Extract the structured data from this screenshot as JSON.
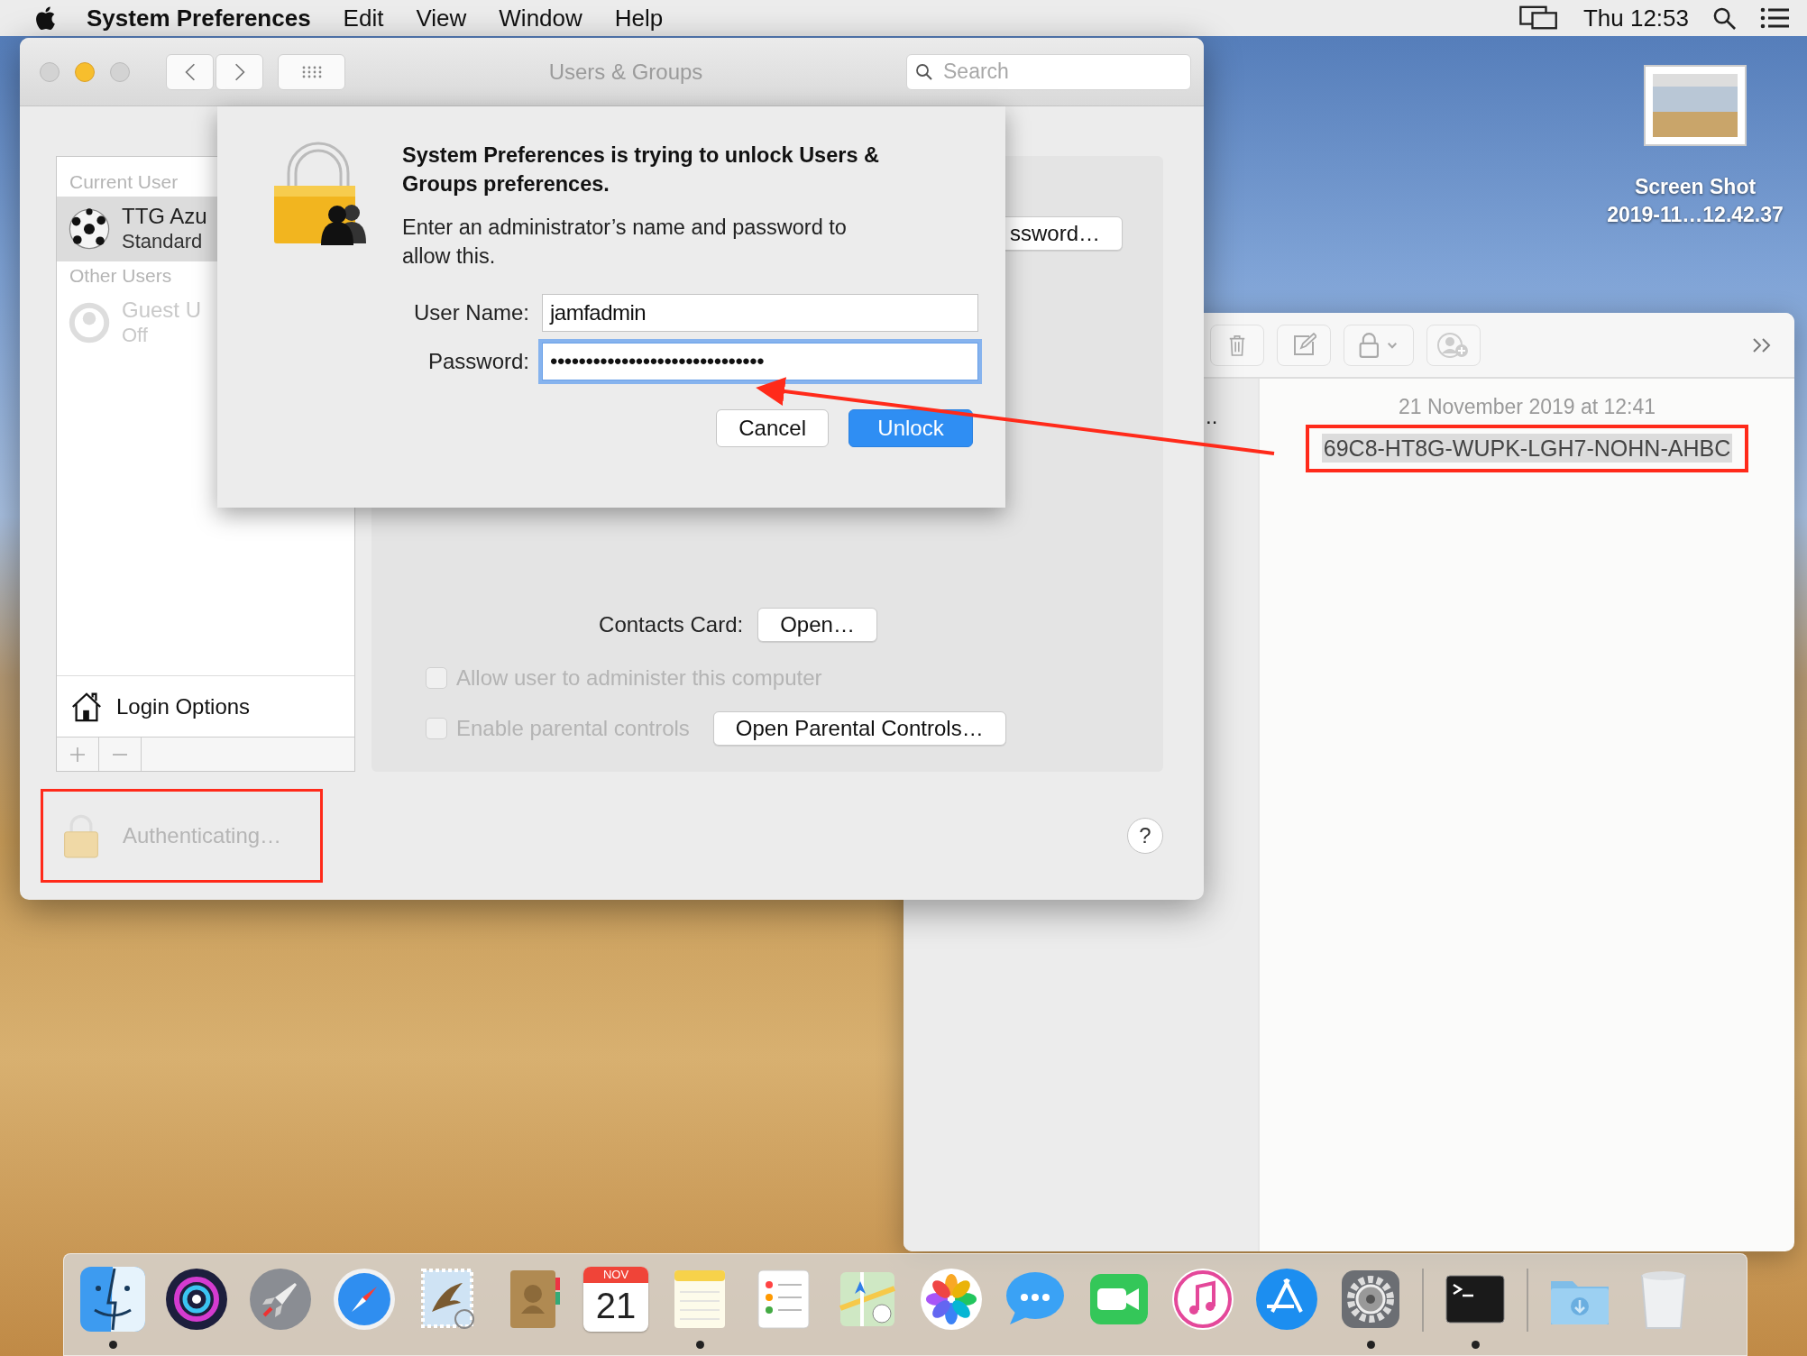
{
  "menu_bar": {
    "app": "System Preferences",
    "menus": [
      "Edit",
      "View",
      "Window",
      "Help"
    ],
    "clock": "Thu 12:53"
  },
  "desktop_icon": {
    "label_lines": [
      "Screen Shot",
      "2019-11…12.42.37"
    ]
  },
  "prefs_window": {
    "title": "Users & Groups",
    "search": {
      "placeholder": "Search"
    },
    "sidebar": {
      "sections": [
        {
          "header": "Current User",
          "users": [
            {
              "name": "TTG Azu",
              "role": "Standard",
              "kind": "ball",
              "selected": true,
              "disabled": false
            }
          ]
        },
        {
          "header": "Other Users",
          "users": [
            {
              "name": "Guest U",
              "role": "Off",
              "kind": "silhouette",
              "selected": false,
              "disabled": true
            }
          ]
        }
      ],
      "login_options": "Login Options"
    },
    "panel": {
      "password_button": "ssword…",
      "contacts_label": "Contacts Card:",
      "contacts_button": "Open…",
      "checkboxes": [
        {
          "label": "Allow user to administer this computer",
          "checked": false,
          "disabled": true
        },
        {
          "label": "Enable parental controls",
          "checked": false,
          "disabled": true
        }
      ],
      "parental_button": "Open Parental Controls…"
    },
    "lock_status": {
      "text": "Authenticating…",
      "highlighted": true
    },
    "help": "?"
  },
  "dialog": {
    "title": "System Preferences is trying to unlock Users & Groups preferences.",
    "message": "Enter an administrator’s name and password to allow this.",
    "fields": [
      {
        "label": "User Name:",
        "value": "jamfadmin",
        "focused": false
      },
      {
        "label": "Password:",
        "value": "••••••••••••••••••••••••••••••",
        "focused": true
      }
    ],
    "buttons": [
      {
        "label": "Cancel",
        "default": false
      },
      {
        "label": "Unlock",
        "default": true
      }
    ]
  },
  "notes_window": {
    "list_fragment": "..",
    "date": "21 November 2019 at 12:41",
    "note_text": "69C8-HT8G-WUPK-LGH7-NOHN-AHBC",
    "selected": true,
    "highlighted": true
  },
  "dock": [
    {
      "kind": "finder",
      "running": true
    },
    {
      "kind": "siri",
      "running": false
    },
    {
      "kind": "launchpad",
      "running": false
    },
    {
      "kind": "safari",
      "running": false
    },
    {
      "kind": "mail",
      "running": false
    },
    {
      "kind": "contacts",
      "running": false
    },
    {
      "kind": "calendar",
      "running": false,
      "month": "NOV",
      "day": "21"
    },
    {
      "kind": "notes",
      "running": true
    },
    {
      "kind": "reminders",
      "running": false
    },
    {
      "kind": "maps",
      "running": false
    },
    {
      "kind": "photos",
      "running": false
    },
    {
      "kind": "messages",
      "running": false
    },
    {
      "kind": "facetime",
      "running": false
    },
    {
      "kind": "itunes",
      "running": false
    },
    {
      "kind": "appstore",
      "running": false
    },
    {
      "kind": "sysprefs",
      "running": true
    },
    {
      "kind": "separator"
    },
    {
      "kind": "terminal",
      "running": true
    },
    {
      "kind": "separator"
    },
    {
      "kind": "downloads",
      "running": false
    },
    {
      "kind": "trash",
      "running": false
    }
  ]
}
